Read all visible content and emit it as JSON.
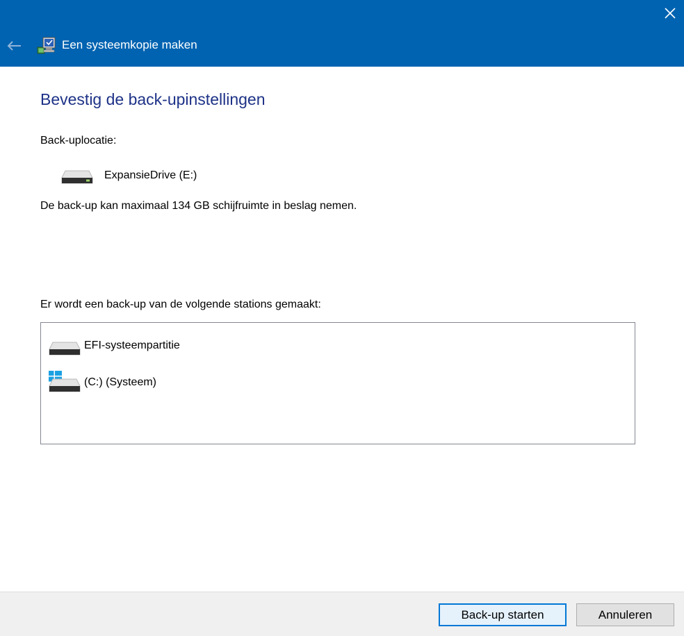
{
  "window": {
    "title": "Een systeemkopie maken"
  },
  "main": {
    "heading": "Bevestig de back-upinstellingen",
    "location_label": "Back-uplocatie:",
    "location_drive": "ExpansieDrive (E:)",
    "space_info": "De back-up kan maximaal 134 GB schijfruimte in beslag nemen.",
    "drives_label": "Er wordt een back-up van de volgende stations gemaakt:",
    "drives": [
      {
        "name": "EFI-systeempartitie",
        "icon": "drive-icon"
      },
      {
        "name": "(C:) (Systeem)",
        "icon": "windows-drive-icon"
      }
    ]
  },
  "footer": {
    "start_label": "Back-up starten",
    "cancel_label": "Annuleren"
  },
  "colors": {
    "titlebar": "#0063b1",
    "heading": "#1e3287",
    "primary_border": "#0078d7"
  }
}
